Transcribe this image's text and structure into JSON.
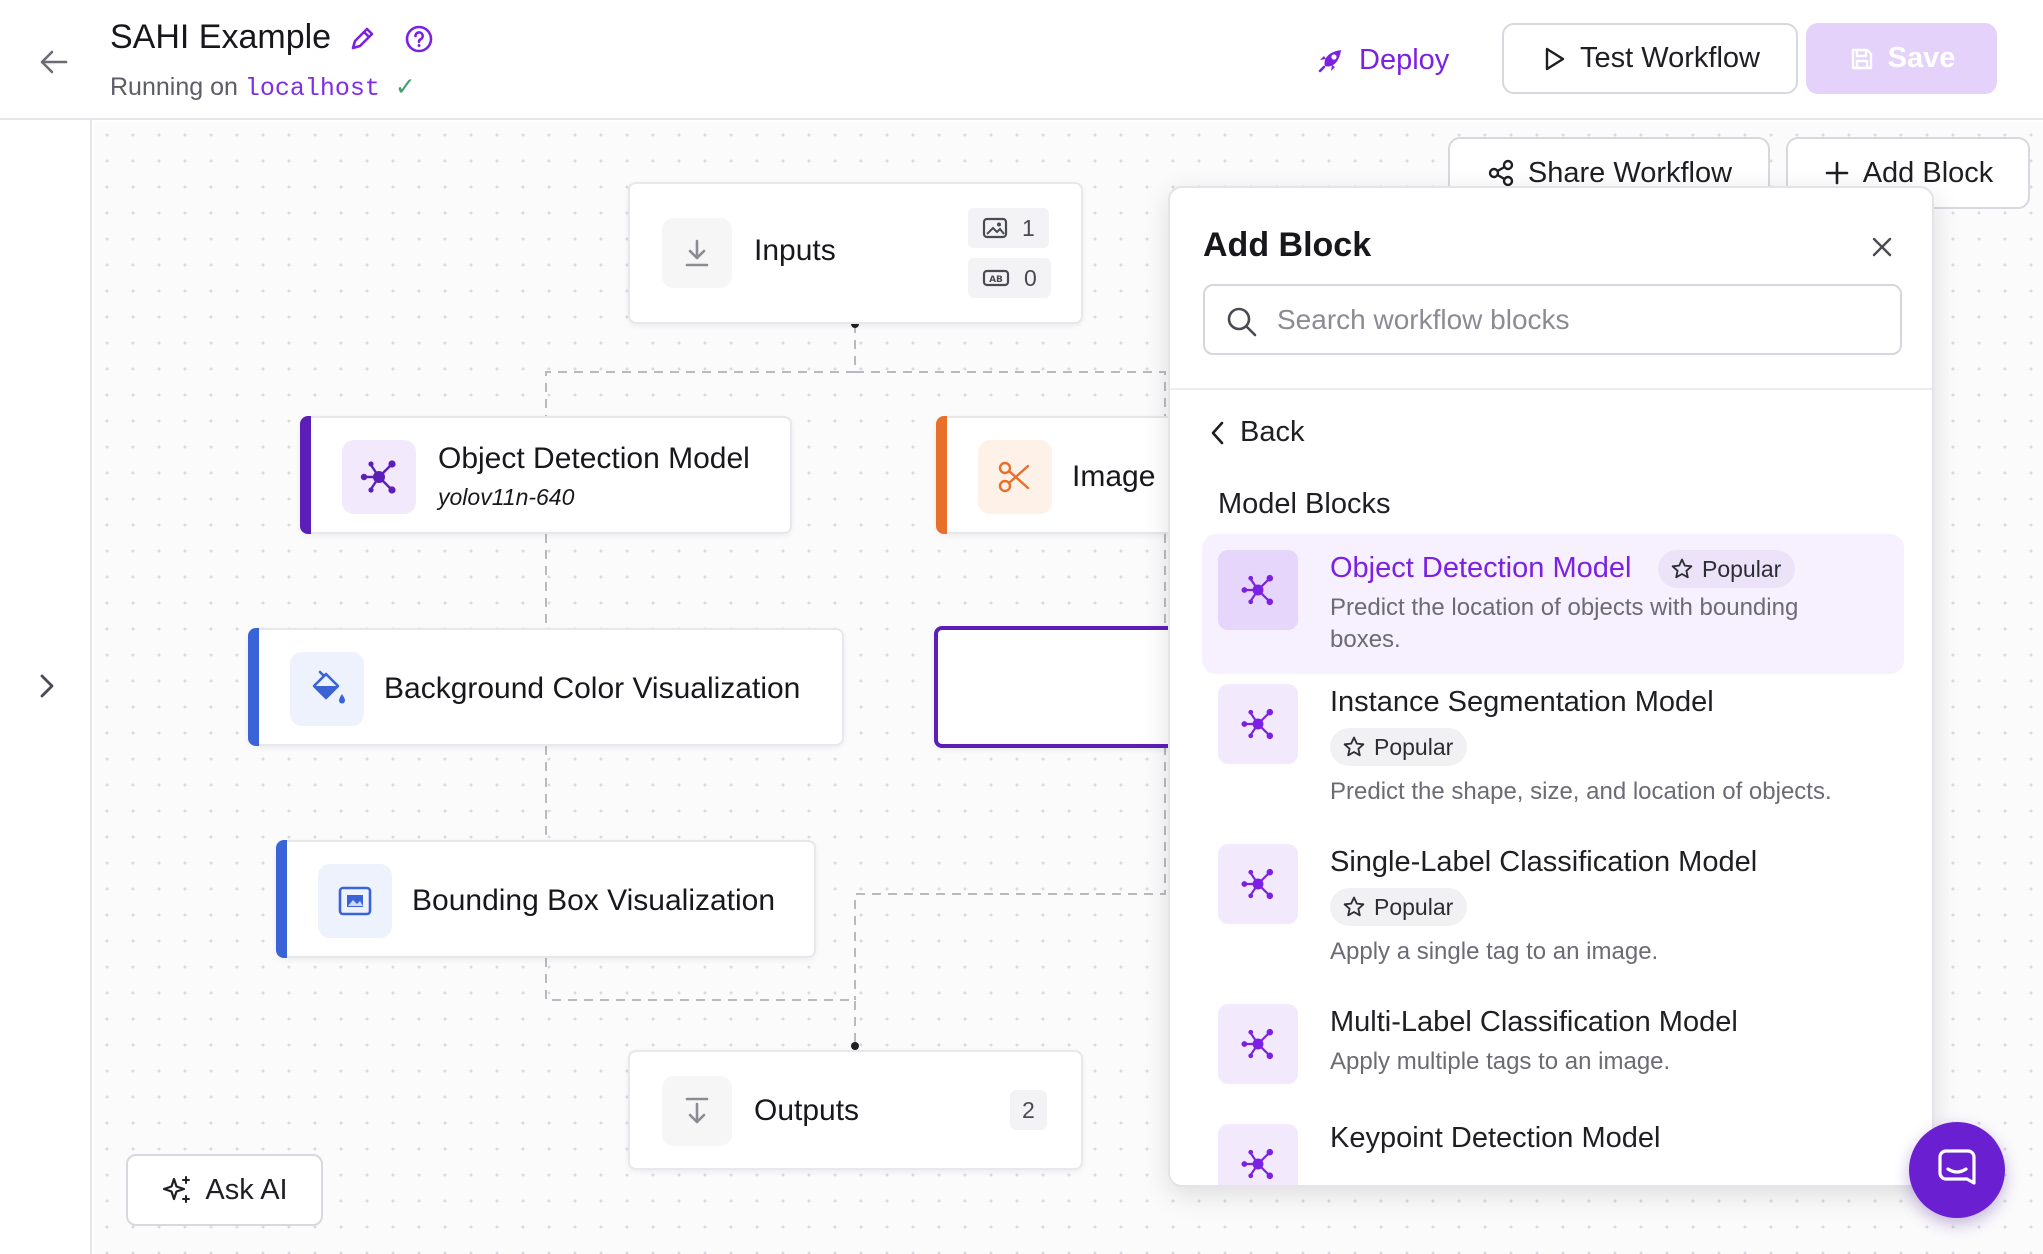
{
  "header": {
    "title": "SAHI Example",
    "running_prefix": "Running on",
    "host": "localhost",
    "deploy_label": "Deploy",
    "test_label": "Test Workflow",
    "save_label": "Save"
  },
  "canvas": {
    "share_label": "Share Workflow",
    "add_block_label": "Add Block",
    "inputs": {
      "label": "Inputs",
      "image_count": "1",
      "param_count": "0"
    },
    "object_detection": {
      "label": "Object Detection Model",
      "model": "yolov11n-640"
    },
    "image_node": {
      "label": "Image"
    },
    "background_color": {
      "label": "Background Color Visualization"
    },
    "bounding_box": {
      "label": "Bounding Box Visualization"
    },
    "outputs": {
      "label": "Outputs",
      "count": "2"
    },
    "ask_ai_label": "Ask AI"
  },
  "panel": {
    "title": "Add Block",
    "search_placeholder": "Search workflow blocks",
    "back_label": "Back",
    "section_title": "Model Blocks",
    "popular_label": "Popular",
    "items": [
      {
        "name": "Object Detection Model",
        "description": "Predict the location of objects with bounding boxes.",
        "popular": true,
        "active": true
      },
      {
        "name": "Instance Segmentation Model",
        "description": "Predict the shape, size, and location of objects.",
        "popular": true
      },
      {
        "name": "Single-Label Classification Model",
        "description": "Apply a single tag to an image.",
        "popular": true
      },
      {
        "name": "Multi-Label Classification Model",
        "description": "Apply multiple tags to an image.",
        "popular": false
      },
      {
        "name": "Keypoint Detection Model",
        "description": "",
        "popular": false
      }
    ]
  },
  "colors": {
    "brand_purple": "#7b22e2",
    "object_detection_accent": "#5b1fb8",
    "image_accent": "#e8702a",
    "visualization_accent": "#3b63d8",
    "save_disabled": "#e4d2fb"
  }
}
